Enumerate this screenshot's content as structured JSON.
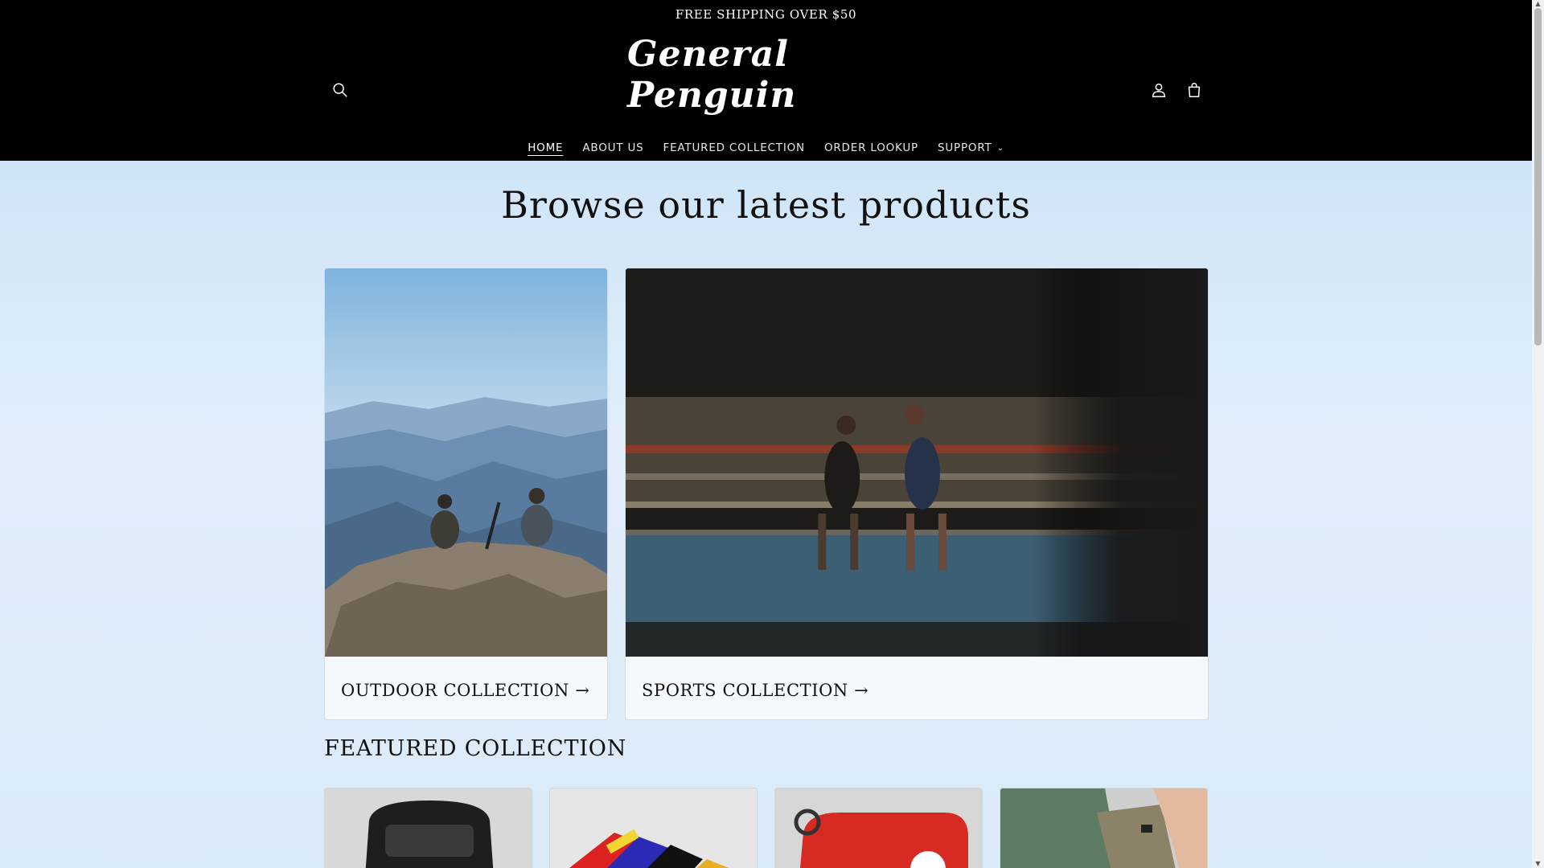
{
  "announcement": {
    "text": "FREE SHIPPING OVER $50"
  },
  "header": {
    "logo_text": "General Penguin",
    "icons": [
      "search-icon",
      "account-icon",
      "cart-icon"
    ]
  },
  "nav": {
    "items": [
      {
        "label": "HOME",
        "active": true
      },
      {
        "label": "ABOUT US",
        "active": false
      },
      {
        "label": "FEATURED COLLECTION",
        "active": false
      },
      {
        "label": "ORDER LOOKUP",
        "active": false
      },
      {
        "label": "SUPPORT",
        "active": false,
        "dropdown": true
      }
    ]
  },
  "main": {
    "title": "Browse our latest products",
    "collections": [
      {
        "label": "OUTDOOR COLLECTION →"
      },
      {
        "label": "SPORTS COLLECTION →"
      }
    ],
    "featured_title": "FEATURED COLLECTION"
  },
  "colors": {
    "header_bg": "#000000",
    "main_bg": "#d6e8f7",
    "text": "#111111"
  }
}
